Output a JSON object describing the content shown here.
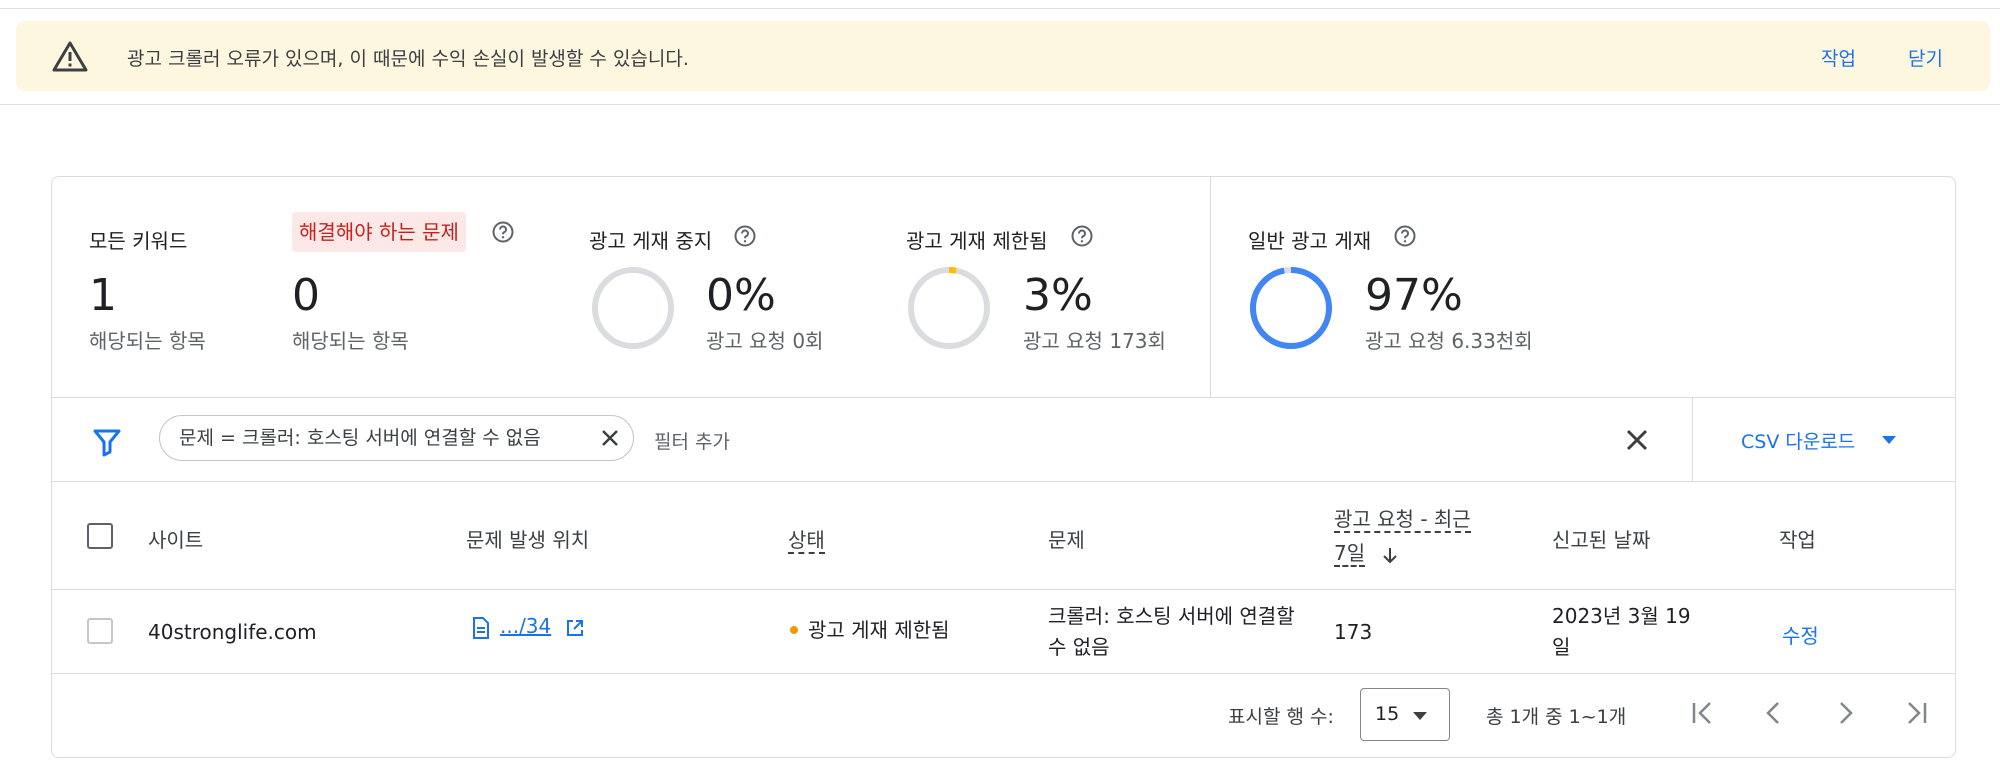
{
  "banner": {
    "icon": "warning-icon",
    "message": "광고 크롤러 오류가 있으며, 이 때문에 수익 손실이 발생할 수 있습니다.",
    "action_label": "작업",
    "close_label": "닫기",
    "background": "#fef7e0"
  },
  "summary": {
    "all_keywords": {
      "label": "모든 키워드",
      "value": "1",
      "sub": "해당되는 항목"
    },
    "issues": {
      "label": "해결해야 하는 문제",
      "value": "0",
      "sub": "해당되는 항목"
    },
    "disabled": {
      "label": "광고 게재 중지",
      "value": "0%",
      "sub": "광고 요청 0회",
      "fraction": 0.0
    },
    "limited": {
      "label": "광고 게재 제한됨",
      "value": "3%",
      "sub": "광고 요청 173회",
      "fraction": 0.03,
      "color": "#fbbc04"
    },
    "normal": {
      "label": "일반 광고 게재",
      "value": "97%",
      "sub": "광고 요청 6.33천회",
      "fraction": 0.97,
      "color": "#4285f4"
    }
  },
  "filter": {
    "chip_text": "문제 = 크롤러: 호스팅 서버에 연결할 수 없음",
    "add_placeholder": "필터 추가",
    "csv_label": "CSV 다운로드"
  },
  "table": {
    "headers": {
      "site": "사이트",
      "location": "문제 발생 위치",
      "status": "상태",
      "issue": "문제",
      "requests_line1": "광고 요청 - 최근",
      "requests_line2": "7일",
      "reported": "신고된 날짜",
      "action": "작업"
    },
    "rows": [
      {
        "site": "40stronglife.com",
        "location": ".../34",
        "status": "광고 게재 제한됨",
        "issue": "크롤러: 호스팅 서버에 연결할 수 없음",
        "requests": "173",
        "reported": "2023년 3월 19일",
        "action": "수정"
      }
    ]
  },
  "pagination": {
    "rows_label": "표시할 행 수:",
    "rows_value": "15",
    "range_text": "총 1개 중 1~1개"
  },
  "colors": {
    "accent": "#1a73e8",
    "issue_chip_bg": "#fce8e6",
    "issue_chip_text": "#c5221f",
    "status_dot": "#f29900"
  }
}
